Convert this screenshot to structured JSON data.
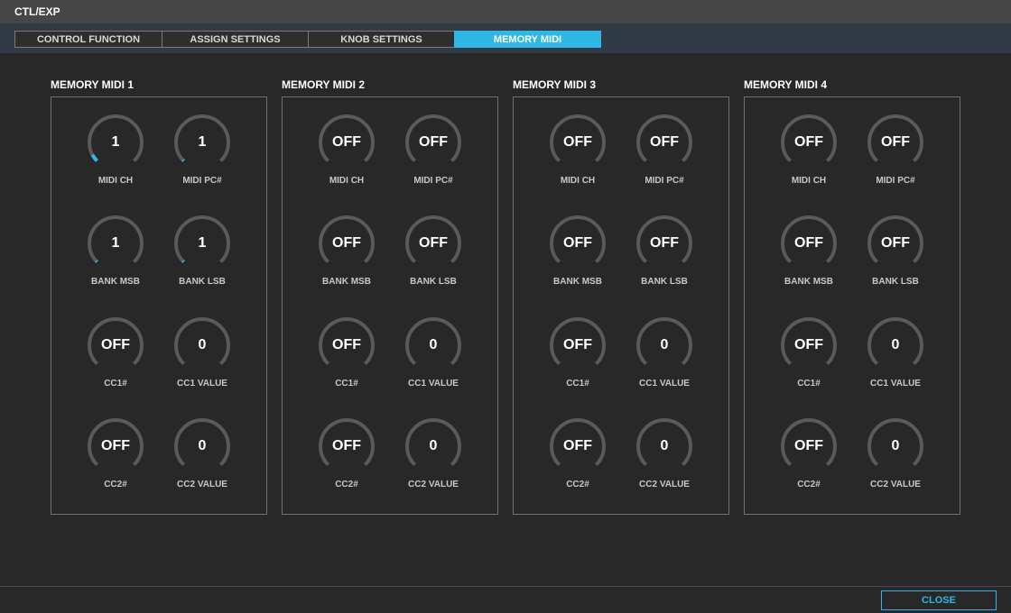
{
  "window": {
    "title": "CTL/EXP"
  },
  "tabs": [
    {
      "label": "CONTROL FUNCTION",
      "active": false
    },
    {
      "label": "ASSIGN SETTINGS",
      "active": false
    },
    {
      "label": "KNOB SETTINGS",
      "active": false
    },
    {
      "label": "MEMORY MIDI",
      "active": true
    }
  ],
  "colors": {
    "accent": "#2fb7e6",
    "knob_track": "#5a5a5a"
  },
  "groups": [
    {
      "title": "MEMORY MIDI 1",
      "knobs": [
        {
          "label": "MIDI CH",
          "value": "1",
          "level": 0.0625
        },
        {
          "label": "MIDI PC#",
          "value": "1",
          "level": 0.01
        },
        {
          "label": "BANK MSB",
          "value": "1",
          "level": 0.01
        },
        {
          "label": "BANK LSB",
          "value": "1",
          "level": 0.01
        },
        {
          "label": "CC1#",
          "value": "OFF",
          "level": 0
        },
        {
          "label": "CC1 VALUE",
          "value": "0",
          "level": 0
        },
        {
          "label": "CC2#",
          "value": "OFF",
          "level": 0
        },
        {
          "label": "CC2 VALUE",
          "value": "0",
          "level": 0
        }
      ]
    },
    {
      "title": "MEMORY MIDI 2",
      "knobs": [
        {
          "label": "MIDI CH",
          "value": "OFF",
          "level": 0
        },
        {
          "label": "MIDI PC#",
          "value": "OFF",
          "level": 0
        },
        {
          "label": "BANK MSB",
          "value": "OFF",
          "level": 0
        },
        {
          "label": "BANK LSB",
          "value": "OFF",
          "level": 0
        },
        {
          "label": "CC1#",
          "value": "OFF",
          "level": 0
        },
        {
          "label": "CC1 VALUE",
          "value": "0",
          "level": 0
        },
        {
          "label": "CC2#",
          "value": "OFF",
          "level": 0
        },
        {
          "label": "CC2 VALUE",
          "value": "0",
          "level": 0
        }
      ]
    },
    {
      "title": "MEMORY MIDI 3",
      "knobs": [
        {
          "label": "MIDI CH",
          "value": "OFF",
          "level": 0
        },
        {
          "label": "MIDI PC#",
          "value": "OFF",
          "level": 0
        },
        {
          "label": "BANK MSB",
          "value": "OFF",
          "level": 0
        },
        {
          "label": "BANK LSB",
          "value": "OFF",
          "level": 0
        },
        {
          "label": "CC1#",
          "value": "OFF",
          "level": 0
        },
        {
          "label": "CC1 VALUE",
          "value": "0",
          "level": 0
        },
        {
          "label": "CC2#",
          "value": "OFF",
          "level": 0
        },
        {
          "label": "CC2 VALUE",
          "value": "0",
          "level": 0
        }
      ]
    },
    {
      "title": "MEMORY MIDI 4",
      "knobs": [
        {
          "label": "MIDI CH",
          "value": "OFF",
          "level": 0
        },
        {
          "label": "MIDI PC#",
          "value": "OFF",
          "level": 0
        },
        {
          "label": "BANK MSB",
          "value": "OFF",
          "level": 0
        },
        {
          "label": "BANK LSB",
          "value": "OFF",
          "level": 0
        },
        {
          "label": "CC1#",
          "value": "OFF",
          "level": 0
        },
        {
          "label": "CC1 VALUE",
          "value": "0",
          "level": 0
        },
        {
          "label": "CC2#",
          "value": "OFF",
          "level": 0
        },
        {
          "label": "CC2 VALUE",
          "value": "0",
          "level": 0
        }
      ]
    }
  ],
  "footer": {
    "close_label": "CLOSE"
  }
}
